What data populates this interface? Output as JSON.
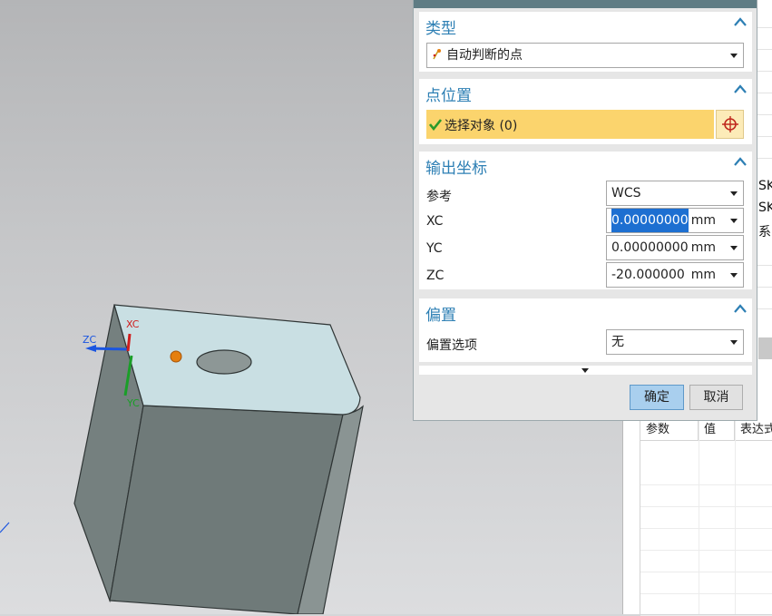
{
  "dialog": {
    "type_section": {
      "title": "类型",
      "selected": "自动判断的点"
    },
    "point_location": {
      "title": "点位置",
      "select_object": "选择对象 (0)"
    },
    "output_coords": {
      "title": "输出坐标",
      "reference_label": "参考",
      "reference_value": "WCS",
      "xc_label": "XC",
      "xc_value": "0.00000000",
      "yc_label": "YC",
      "yc_value": "0.00000000",
      "zc_label": "ZC",
      "zc_value": "-20.000000",
      "unit": "mm"
    },
    "offset": {
      "title": "偏置",
      "option_label": "偏置选项",
      "option_value": "无"
    },
    "ok_label": "确定",
    "cancel_label": "取消"
  },
  "viewport": {
    "axis_xc": "XC",
    "axis_yc": "YC",
    "axis_zc": "ZC"
  },
  "right_panel": {
    "partial_1": "SK",
    "partial_2": "SK",
    "partial_3": "系",
    "columns": [
      "参数",
      "值",
      "表达式"
    ]
  },
  "icons": {
    "type_icon": "inferred-point-icon",
    "check": "checkmark-icon",
    "point_dialog": "crosshair-point-icon"
  },
  "colors": {
    "accent": "#2d7fb4",
    "selection_bar": "#fbd46d",
    "ok_button": "#a9cfee",
    "title_bar": "#5f7c84"
  }
}
